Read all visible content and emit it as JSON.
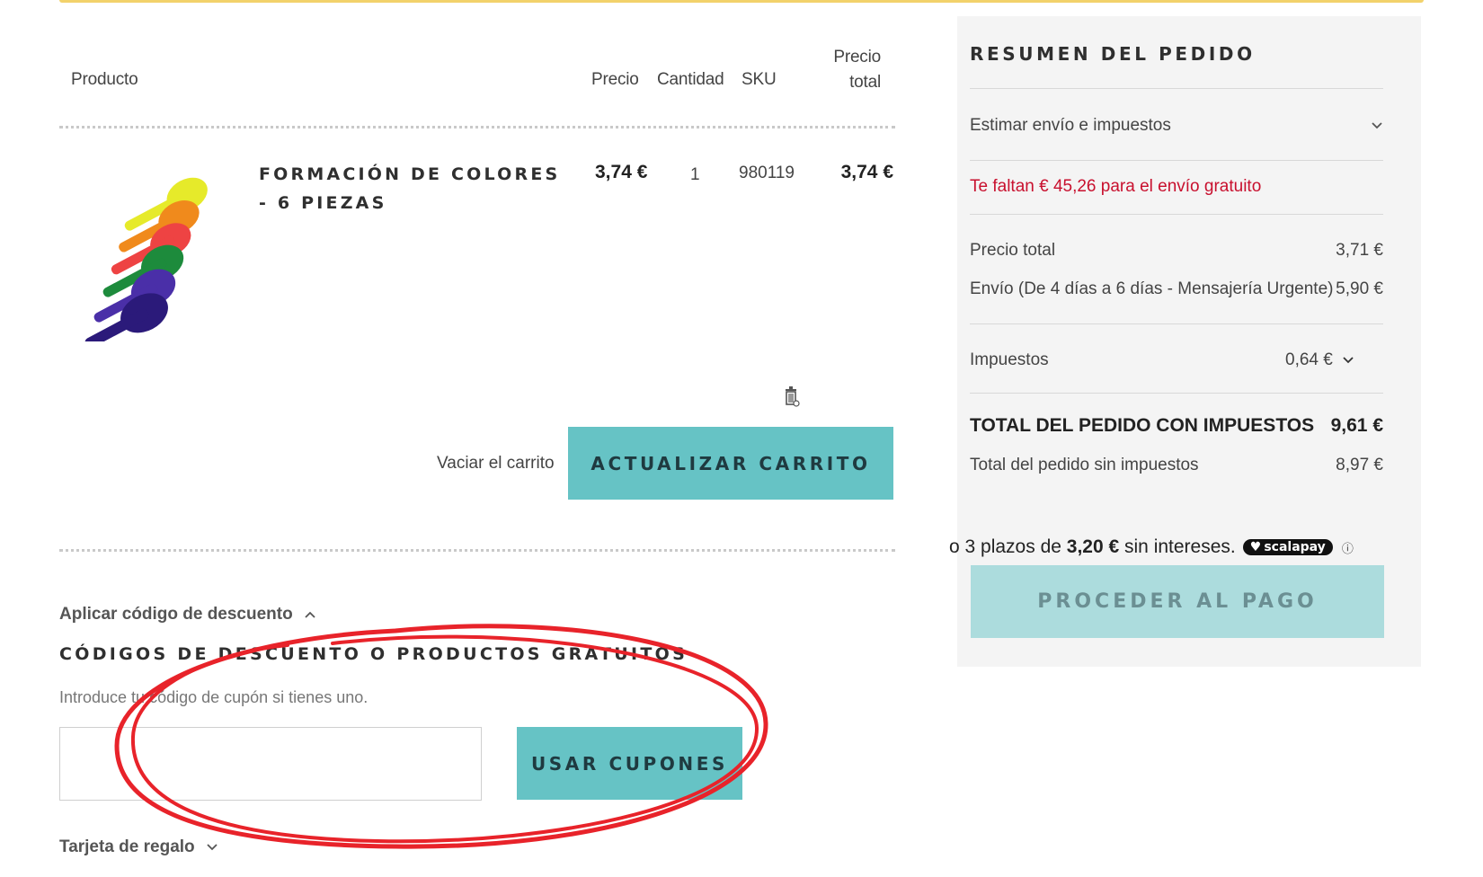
{
  "cart": {
    "headers": {
      "product": "Producto",
      "price": "Precio",
      "quantity": "Cantidad",
      "sku": "SKU",
      "total_line1": "Precio",
      "total_line2": "total"
    },
    "item": {
      "name": "FORMACIÓN DE COLORES - 6 PIEZAS",
      "price": "3,74 €",
      "quantity": "1",
      "sku": "980119",
      "total": "3,74 €",
      "image_icon": "colored-spoons-image"
    },
    "empty_cart_label": "Vaciar el carrito",
    "update_cart_label": "ACTUALIZAR CARRITO"
  },
  "discount": {
    "toggle_label": "Aplicar código de descuento",
    "title": "CÓDIGOS DE DESCUENTO O PRODUCTOS GRATUITOS",
    "hint": "Introduce tu código de cupón si tienes uno.",
    "input_value": "",
    "apply_label": "USAR CUPONES"
  },
  "gift_card": {
    "toggle_label": "Tarjeta de regalo"
  },
  "summary": {
    "title": "RESUMEN DEL PEDIDO",
    "estimate_label": "Estimar envío e impuestos",
    "free_shipping_msg": "Te faltan € 45,26 para el envío gratuito",
    "subtotal_label": "Precio total",
    "subtotal_value": "3,71 €",
    "shipping_label": "Envío (De 4 días a 6 días - Mensajería Urgente)",
    "shipping_value": "5,90 €",
    "tax_label": "Impuestos",
    "tax_value": "0,64 €",
    "grand_total_label": "TOTAL DEL PEDIDO CON IMPUESTOS",
    "grand_total_value": "9,61 €",
    "excl_tax_label": "Total del pedido sin impuestos",
    "excl_tax_value": "8,97 €"
  },
  "scalapay": {
    "prefix": "o 3 plazos de",
    "amount": "3,20 €",
    "suffix": "sin intereses.",
    "badge": "scalapay"
  },
  "checkout_label": "PROCEDER AL PAGO",
  "colors": {
    "teal": "#66c3c5",
    "teal_disabled": "#acdcdd",
    "warning": "#c8102e",
    "annotation": "#e8232a"
  }
}
